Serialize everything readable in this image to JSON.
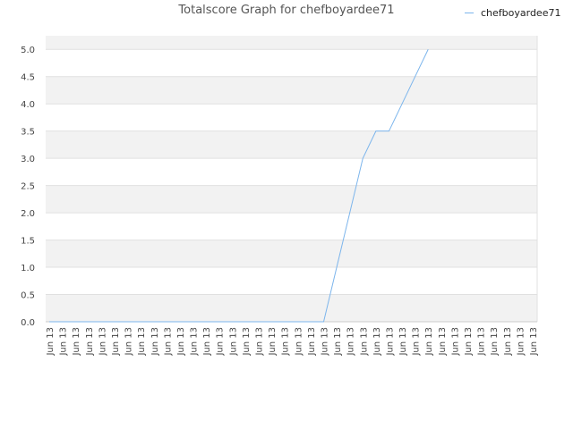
{
  "chart_data": {
    "type": "line",
    "title": "Totalscore Graph for chefboyardee71",
    "xlabel": "",
    "ylabel": "",
    "ylim": [
      0,
      5.25
    ],
    "yticks": [
      "0.0",
      "0.5",
      "1.0",
      "1.5",
      "2.0",
      "2.5",
      "3.0",
      "3.5",
      "4.0",
      "4.5",
      "5.0"
    ],
    "categories": [
      "Jun 13",
      "Jun 13",
      "Jun 13",
      "Jun 13",
      "Jun 13",
      "Jun 13",
      "Jun 13",
      "Jun 13",
      "Jun 13",
      "Jun 13",
      "Jun 13",
      "Jun 13",
      "Jun 13",
      "Jun 13",
      "Jun 13",
      "Jun 13",
      "Jun 13",
      "Jun 13",
      "Jun 13",
      "Jun 13",
      "Jun 13",
      "Jun 13",
      "Jun 13",
      "Jun 13",
      "Jun 13",
      "Jun 13",
      "Jun 13",
      "Jun 13",
      "Jun 13",
      "Jun 13",
      "Jun 13",
      "Jun 13",
      "Jun 13",
      "Jun 13",
      "Jun 13",
      "Jun 13",
      "Jun 13",
      "Jun 13"
    ],
    "series": [
      {
        "name": "chefboyardee71",
        "color": "#7cb5ec",
        "values": [
          0,
          0,
          0,
          0,
          0,
          0,
          0,
          0,
          0,
          0,
          0,
          0,
          0,
          0,
          0,
          0,
          0,
          0,
          0,
          0,
          0,
          0,
          1,
          2,
          3,
          3.5,
          3.5,
          4,
          4.5,
          5
        ]
      }
    ],
    "grid": true,
    "legend_position": "top-right",
    "band_color": "#f2f2f2"
  }
}
